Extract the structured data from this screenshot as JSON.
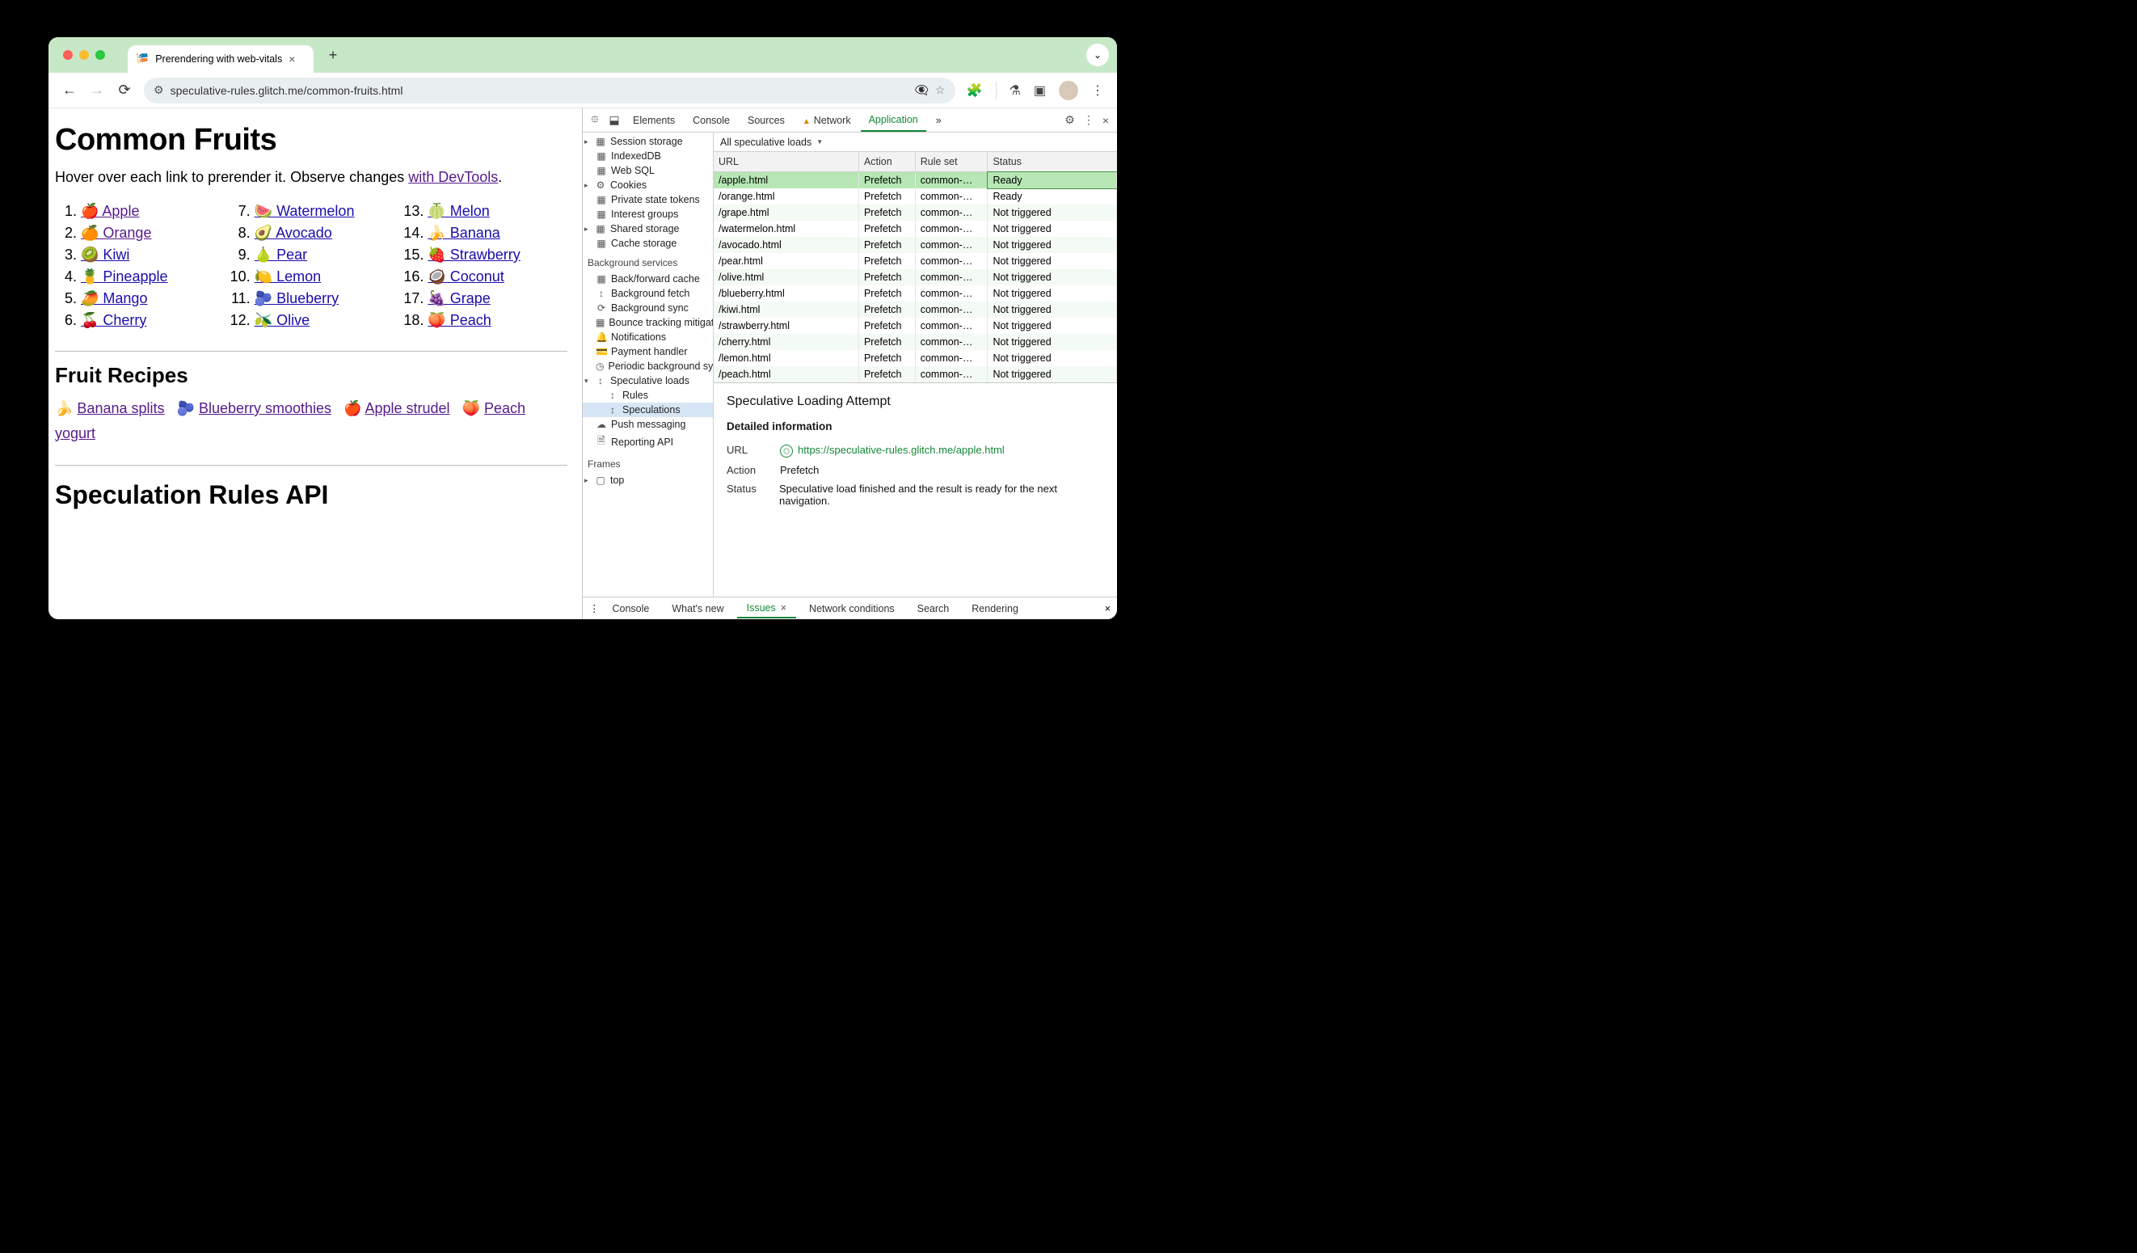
{
  "window": {
    "tab_title": "Prerendering with web-vitals",
    "url_display": "speculative-rules.glitch.me/common-fruits.html"
  },
  "page": {
    "h1": "Common Fruits",
    "intro_prefix": "Hover over each link to prerender it. Observe changes ",
    "intro_link": "with DevTools",
    "intro_suffix": ".",
    "fruit_links": [
      {
        "n": 1,
        "emoji": "🍎",
        "text": "Apple",
        "visited": true
      },
      {
        "n": 2,
        "emoji": "🍊",
        "text": "Orange",
        "visited": true
      },
      {
        "n": 3,
        "emoji": "🥝",
        "text": "Kiwi",
        "visited": false
      },
      {
        "n": 4,
        "emoji": "🍍",
        "text": "Pineapple",
        "visited": false
      },
      {
        "n": 5,
        "emoji": "🥭",
        "text": "Mango",
        "visited": false
      },
      {
        "n": 6,
        "emoji": "🍒",
        "text": "Cherry",
        "visited": false
      },
      {
        "n": 7,
        "emoji": "🍉",
        "text": "Watermelon",
        "visited": false
      },
      {
        "n": 8,
        "emoji": "🥑",
        "text": "Avocado",
        "visited": false
      },
      {
        "n": 9,
        "emoji": "🍐",
        "text": "Pear",
        "visited": false
      },
      {
        "n": 10,
        "emoji": "🍋",
        "text": "Lemon",
        "visited": false
      },
      {
        "n": 11,
        "emoji": "🫐",
        "text": "Blueberry",
        "visited": false
      },
      {
        "n": 12,
        "emoji": "🫒",
        "text": "Olive",
        "visited": false
      },
      {
        "n": 13,
        "emoji": "🍈",
        "text": "Melon",
        "visited": false
      },
      {
        "n": 14,
        "emoji": "🍌",
        "text": "Banana",
        "visited": false
      },
      {
        "n": 15,
        "emoji": "🍓",
        "text": "Strawberry",
        "visited": false
      },
      {
        "n": 16,
        "emoji": "🥥",
        "text": "Coconut",
        "visited": false
      },
      {
        "n": 17,
        "emoji": "🍇",
        "text": "Grape",
        "visited": false
      },
      {
        "n": 18,
        "emoji": "🍑",
        "text": "Peach",
        "visited": false
      }
    ],
    "h2_recipes": "Fruit Recipes",
    "recipes": [
      {
        "emoji": "🍌",
        "text": "Banana splits"
      },
      {
        "emoji": "🫐",
        "text": "Blueberry smoothies"
      },
      {
        "emoji": "🍎",
        "text": "Apple strudel"
      },
      {
        "emoji": "🍑",
        "text": "Peach yogurt"
      }
    ],
    "h2_spec": "Speculation Rules API"
  },
  "devtools": {
    "tabs": [
      "Elements",
      "Console",
      "Sources",
      "Network",
      "Application"
    ],
    "active_tab": "Application",
    "more": "»",
    "side_storage": [
      {
        "icon": "▦",
        "label": "Session storage",
        "expand": true
      },
      {
        "icon": "▦",
        "label": "IndexedDB"
      },
      {
        "icon": "▦",
        "label": "Web SQL"
      },
      {
        "icon": "⚙",
        "label": "Cookies",
        "expand": true
      },
      {
        "icon": "▦",
        "label": "Private state tokens"
      },
      {
        "icon": "▦",
        "label": "Interest groups"
      },
      {
        "icon": "▦",
        "label": "Shared storage",
        "expand": true
      },
      {
        "icon": "▦",
        "label": "Cache storage"
      }
    ],
    "bg_heading": "Background services",
    "side_bg": [
      {
        "icon": "▦",
        "label": "Back/forward cache"
      },
      {
        "icon": "↕",
        "label": "Background fetch"
      },
      {
        "icon": "⟳",
        "label": "Background sync"
      },
      {
        "icon": "▦",
        "label": "Bounce tracking mitigations"
      },
      {
        "icon": "🔔",
        "label": "Notifications"
      },
      {
        "icon": "💳",
        "label": "Payment handler"
      },
      {
        "icon": "◷",
        "label": "Periodic background sync"
      },
      {
        "icon": "↕",
        "label": "Speculative loads",
        "expand": true,
        "open": true
      },
      {
        "icon": "↕",
        "label": "Rules",
        "child": true
      },
      {
        "icon": "↕",
        "label": "Speculations",
        "child": true,
        "selected": true
      },
      {
        "icon": "☁",
        "label": "Push messaging"
      },
      {
        "icon": "🗎",
        "label": "Reporting API"
      }
    ],
    "frames_heading": "Frames",
    "frames": [
      {
        "icon": "▢",
        "label": "top",
        "expand": true
      }
    ],
    "filter_label": "All speculative loads",
    "table_headers": [
      "URL",
      "Action",
      "Rule set",
      "Status"
    ],
    "speculations": [
      {
        "url": "/apple.html",
        "action": "Prefetch",
        "rule": "common-…",
        "status": "Ready",
        "selected": true
      },
      {
        "url": "/orange.html",
        "action": "Prefetch",
        "rule": "common-…",
        "status": "Ready"
      },
      {
        "url": "/grape.html",
        "action": "Prefetch",
        "rule": "common-…",
        "status": "Not triggered"
      },
      {
        "url": "/watermelon.html",
        "action": "Prefetch",
        "rule": "common-…",
        "status": "Not triggered"
      },
      {
        "url": "/avocado.html",
        "action": "Prefetch",
        "rule": "common-…",
        "status": "Not triggered"
      },
      {
        "url": "/pear.html",
        "action": "Prefetch",
        "rule": "common-…",
        "status": "Not triggered"
      },
      {
        "url": "/olive.html",
        "action": "Prefetch",
        "rule": "common-…",
        "status": "Not triggered"
      },
      {
        "url": "/blueberry.html",
        "action": "Prefetch",
        "rule": "common-…",
        "status": "Not triggered"
      },
      {
        "url": "/kiwi.html",
        "action": "Prefetch",
        "rule": "common-…",
        "status": "Not triggered"
      },
      {
        "url": "/strawberry.html",
        "action": "Prefetch",
        "rule": "common-…",
        "status": "Not triggered"
      },
      {
        "url": "/cherry.html",
        "action": "Prefetch",
        "rule": "common-…",
        "status": "Not triggered"
      },
      {
        "url": "/lemon.html",
        "action": "Prefetch",
        "rule": "common-…",
        "status": "Not triggered"
      },
      {
        "url": "/peach.html",
        "action": "Prefetch",
        "rule": "common-…",
        "status": "Not triggered"
      }
    ],
    "detail": {
      "title": "Speculative Loading Attempt",
      "section": "Detailed information",
      "url_label": "URL",
      "url_value": "https://speculative-rules.glitch.me/apple.html",
      "action_label": "Action",
      "action_value": "Prefetch",
      "status_label": "Status",
      "status_value": "Speculative load finished and the result is ready for the next navigation."
    },
    "drawer": [
      "Console",
      "What's new",
      "Issues",
      "Network conditions",
      "Search",
      "Rendering"
    ],
    "drawer_active": "Issues"
  }
}
